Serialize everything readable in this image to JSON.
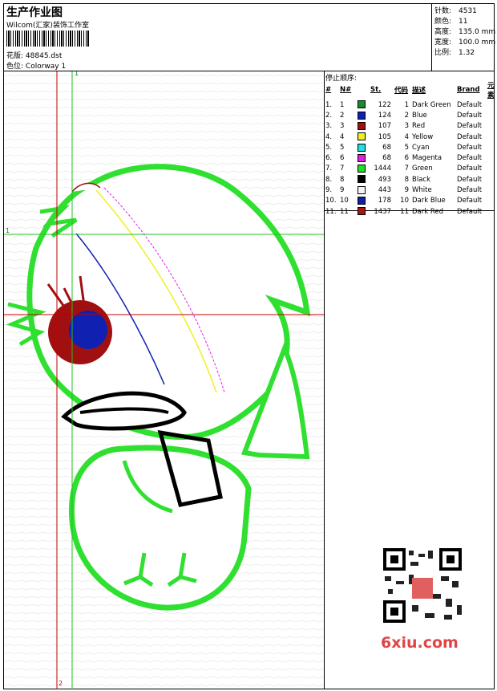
{
  "header": {
    "title": "生产作业图",
    "company": "Wilcom(汇家)装饰工作室",
    "design_file_label": "花版:",
    "design_file": "48845.dst",
    "colorway_label": "色位:",
    "colorway": "Colorway 1"
  },
  "info": [
    {
      "label": "针数:",
      "value": "4531"
    },
    {
      "label": "颜色:",
      "value": "11"
    },
    {
      "label": "高度:",
      "value": "135.0 mm"
    },
    {
      "label": "宽度:",
      "value": "100.0 mm"
    },
    {
      "label": "比例:",
      "value": "1.32"
    }
  ],
  "stop_sequence": {
    "title": "停止顺序:",
    "headers": {
      "seq": "#",
      "needle": "N#",
      "st": "St.",
      "code": "代码",
      "desc": "描述",
      "brand": "Brand",
      "element": "元素"
    },
    "rows": [
      {
        "seq": "1.",
        "needle": "1",
        "color": "#1a8a2a",
        "st": "122",
        "code": "1",
        "desc": "Dark Green",
        "brand": "Default"
      },
      {
        "seq": "2.",
        "needle": "2",
        "color": "#1020b0",
        "st": "124",
        "code": "2",
        "desc": "Blue",
        "brand": "Default"
      },
      {
        "seq": "3.",
        "needle": "3",
        "color": "#a01010",
        "st": "107",
        "code": "3",
        "desc": "Red",
        "brand": "Default"
      },
      {
        "seq": "4.",
        "needle": "4",
        "color": "#f0f020",
        "st": "105",
        "code": "4",
        "desc": "Yellow",
        "brand": "Default"
      },
      {
        "seq": "5.",
        "needle": "5",
        "color": "#20e0e0",
        "st": "68",
        "code": "5",
        "desc": "Cyan",
        "brand": "Default"
      },
      {
        "seq": "6.",
        "needle": "6",
        "color": "#e020e0",
        "st": "68",
        "code": "6",
        "desc": "Magenta",
        "brand": "Default"
      },
      {
        "seq": "7.",
        "needle": "7",
        "color": "#20e020",
        "st": "1444",
        "code": "7",
        "desc": "Green",
        "brand": "Default"
      },
      {
        "seq": "8.",
        "needle": "8",
        "color": "#000000",
        "st": "493",
        "code": "8",
        "desc": "Black",
        "brand": "Default"
      },
      {
        "seq": "9.",
        "needle": "9",
        "color": "#f4f4f4",
        "st": "443",
        "code": "9",
        "desc": "White",
        "brand": "Default"
      },
      {
        "seq": "10.",
        "needle": "10",
        "color": "#1020a0",
        "st": "178",
        "code": "10",
        "desc": "Dark Blue",
        "brand": "Default"
      },
      {
        "seq": "11.",
        "needle": "11",
        "color": "#a01818",
        "st": "1437",
        "code": "11",
        "desc": "Dark Red",
        "brand": "Default"
      }
    ]
  },
  "guides": {
    "v1": "1",
    "h1": "1",
    "v2": "2"
  },
  "watermark": "6xiu.com"
}
